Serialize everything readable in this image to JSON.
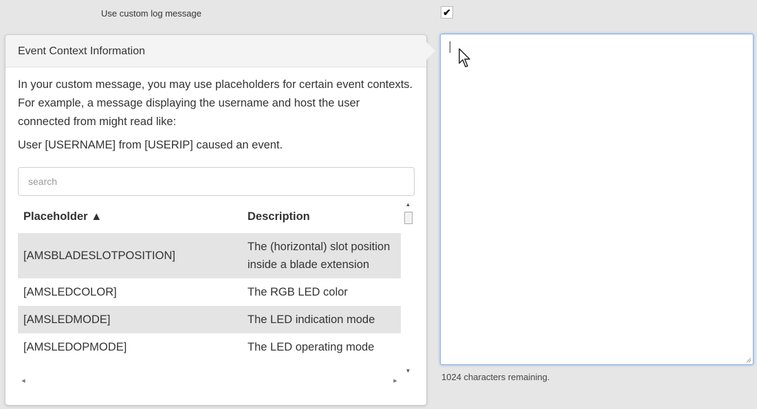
{
  "top": {
    "label": "Use custom log message",
    "checkbox_mark": "✔",
    "checked": true
  },
  "popover": {
    "title": "Event Context Information",
    "intro": "In your custom message, you may use placeholders for certain event contexts. For example, a message displaying the username and host the user connected from might read like:",
    "example": "User [USERNAME] from [USERIP] caused an event.",
    "search_placeholder": "search",
    "columns": {
      "placeholder": "Placeholder ▲",
      "description": "Description"
    },
    "rows": [
      {
        "placeholder": "[AMSBLADESLOTPOSITION]",
        "description": "The (horizontal) slot position inside a blade extension"
      },
      {
        "placeholder": "[AMSLEDCOLOR]",
        "description": "The RGB LED color"
      },
      {
        "placeholder": "[AMSLEDMODE]",
        "description": "The LED indication mode"
      },
      {
        "placeholder": "[AMSLEDOPMODE]",
        "description": "The LED operating mode"
      }
    ],
    "scroll_icons": {
      "up": "scroll-up-arrow-icon",
      "down": "scroll-down-arrow-icon",
      "left": "scroll-left-arrow-icon",
      "right": "scroll-right-arrow-icon"
    }
  },
  "editor": {
    "value": "",
    "remaining_text": "1024 characters remaining."
  },
  "colors": {
    "page_bg": "#e6e6e6",
    "focus_border": "#7fb0e0",
    "row_alt": "#e4e4e4"
  },
  "icons": {
    "cursor": "mouse-pointer-icon",
    "resize": "resize-grip-icon"
  }
}
